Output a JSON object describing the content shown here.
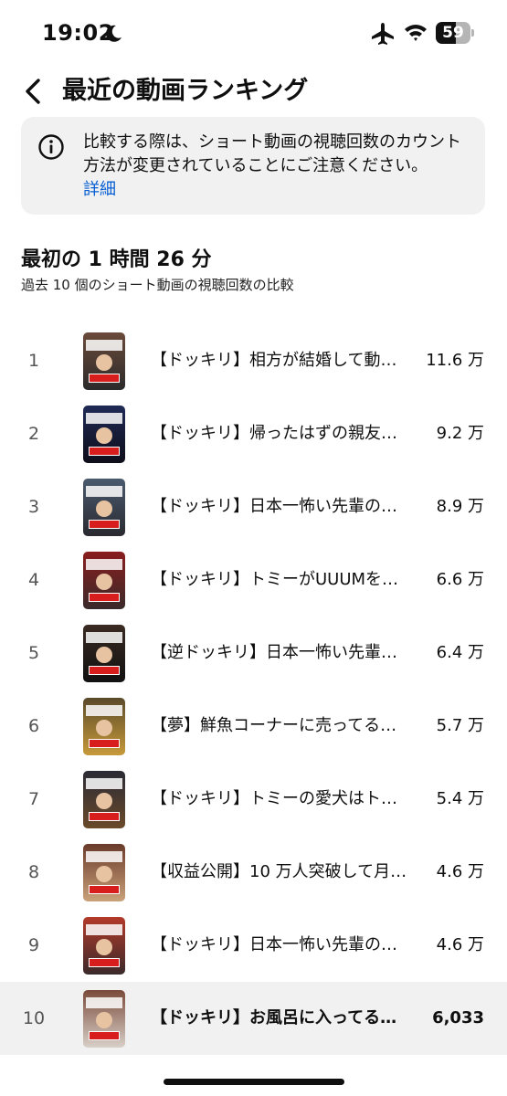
{
  "status_bar": {
    "time": "19:02",
    "battery": "59",
    "battery_level": 0.59
  },
  "header": {
    "title": "最近の動画ランキング"
  },
  "notice": {
    "text": "比較する際は、ショート動画の視聴回数のカウント方法が変更されていることにご注意ください。",
    "link": "詳細"
  },
  "section": {
    "title": "最初の 1 時間 26 分",
    "subtitle": "過去 10 個のショート動画の視聴回数の比較"
  },
  "rankings": [
    {
      "rank": "1",
      "title": "【ドッキリ】相方が結婚して動画が…",
      "views": "11.6 万",
      "thumb_colors": [
        "#6b4a3a",
        "#2b2b2b"
      ]
    },
    {
      "rank": "2",
      "title": "【ドッキリ】帰ったはずの親友が…",
      "views": "9.2 万",
      "thumb_colors": [
        "#1f2a55",
        "#0e0e1a"
      ]
    },
    {
      "rank": "3",
      "title": "【ドッキリ】日本一怖い先輩の目…",
      "views": "8.9 万",
      "thumb_colors": [
        "#4a5a6e",
        "#2a2a30"
      ]
    },
    {
      "rank": "4",
      "title": "【ドッキリ】トミーがUUUMを…",
      "views": "6.6 万",
      "thumb_colors": [
        "#8a1d1d",
        "#3a2a2a"
      ]
    },
    {
      "rank": "5",
      "title": "【逆ドッキリ】日本一怖い先輩が…",
      "views": "6.4 万",
      "thumb_colors": [
        "#3a2a22",
        "#111111"
      ]
    },
    {
      "rank": "6",
      "title": "【夢】鮮魚コーナーに売ってる『…",
      "views": "5.7 万",
      "thumb_colors": [
        "#5a4a2a",
        "#c79a3a"
      ]
    },
    {
      "rank": "7",
      "title": "【ドッキリ】トミーの愛犬はトミ…",
      "views": "5.4 万",
      "thumb_colors": [
        "#2a2a35",
        "#6a4a2a"
      ]
    },
    {
      "rank": "8",
      "title": "【収益公開】10 万人突破して月…",
      "views": "4.6 万",
      "thumb_colors": [
        "#6a3a2a",
        "#c9a27a"
      ]
    },
    {
      "rank": "9",
      "title": "【ドッキリ】日本一怖い先輩の家…",
      "views": "4.6 万",
      "thumb_colors": [
        "#b23a2a",
        "#3a2a2a"
      ]
    },
    {
      "rank": "10",
      "title": "【ドッキリ】お風呂に入ってる…",
      "views": "6,033",
      "thumb_colors": [
        "#7a4a3a",
        "#d8d0c8"
      ],
      "highlight": true
    }
  ],
  "colors": {
    "link": "#065fd4",
    "notice_bg": "#f1f1f1",
    "highlight_bg": "#f1f1f1"
  },
  "icons": {
    "back": "chevron-left-icon",
    "info": "info-icon",
    "moon": "moon-icon",
    "airplane": "airplane-icon",
    "wifi": "wifi-icon",
    "battery": "battery-icon"
  }
}
